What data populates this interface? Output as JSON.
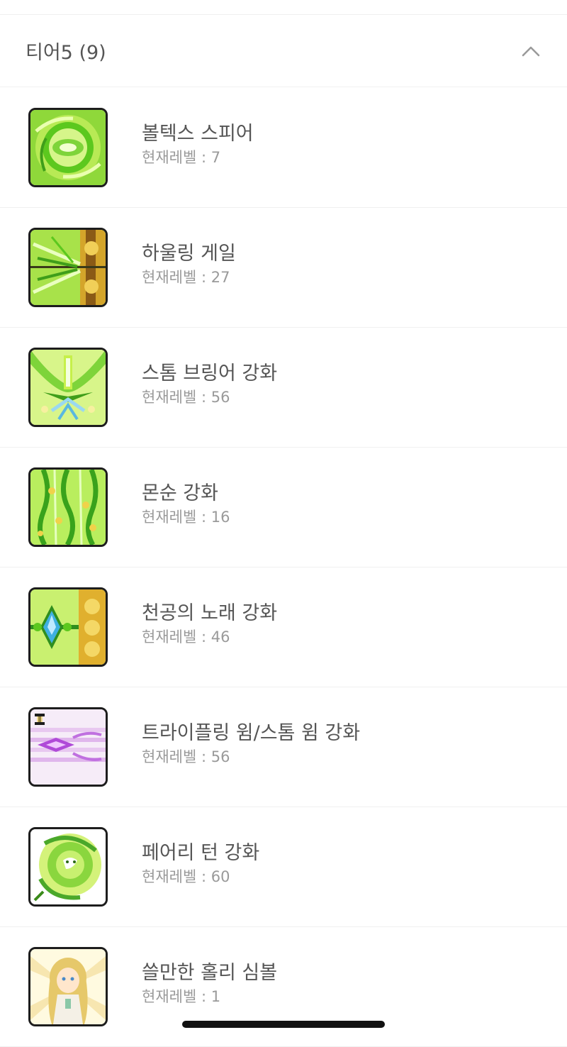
{
  "section": {
    "title": "티어5 (9)",
    "chevron_icon": "chevron-up-icon"
  },
  "level_prefix": "현재레벨 : ",
  "skills": [
    {
      "name": "볼텍스 스피어",
      "level": "현재레벨 : 7",
      "icon": "vortex-spear-icon",
      "colors": [
        "#c6f04a",
        "#5cc81e",
        "#eaffb0"
      ]
    },
    {
      "name": "하울링 게일",
      "level": "현재레벨 : 27",
      "icon": "howling-gale-icon",
      "colors": [
        "#a8e24a",
        "#3f9e1a",
        "#d4a52a"
      ]
    },
    {
      "name": "스톰 브링어 강화",
      "level": "현재레벨 : 56",
      "icon": "storm-bringer-icon",
      "colors": [
        "#d8f58a",
        "#4fb62a",
        "#9ad8f0"
      ]
    },
    {
      "name": "몬순 강화",
      "level": "현재레벨 : 16",
      "icon": "monsoon-icon",
      "colors": [
        "#b9ee5e",
        "#39a21c",
        "#f0d24a"
      ]
    },
    {
      "name": "천공의 노래 강화",
      "level": "현재레벨 : 46",
      "icon": "song-of-heaven-icon",
      "colors": [
        "#c9f070",
        "#2f8e1e",
        "#3fb0e0"
      ]
    },
    {
      "name": "트라이플링 윔/스톰 윔 강화",
      "level": "현재레벨 : 56",
      "icon": "trifling-whim-icon",
      "colors": [
        "#f1d6f5",
        "#b04ad8",
        "#ffffff"
      ]
    },
    {
      "name": "페어리 턴 강화",
      "level": "현재레벨 : 60",
      "icon": "fairy-turn-icon",
      "colors": [
        "#d4f27a",
        "#4aa82a",
        "#ffffff"
      ]
    },
    {
      "name": "쓸만한 홀리 심볼",
      "level": "현재레벨 : 1",
      "icon": "holy-symbol-icon",
      "colors": [
        "#fff4c4",
        "#e0c060",
        "#f7e6b0"
      ]
    }
  ]
}
